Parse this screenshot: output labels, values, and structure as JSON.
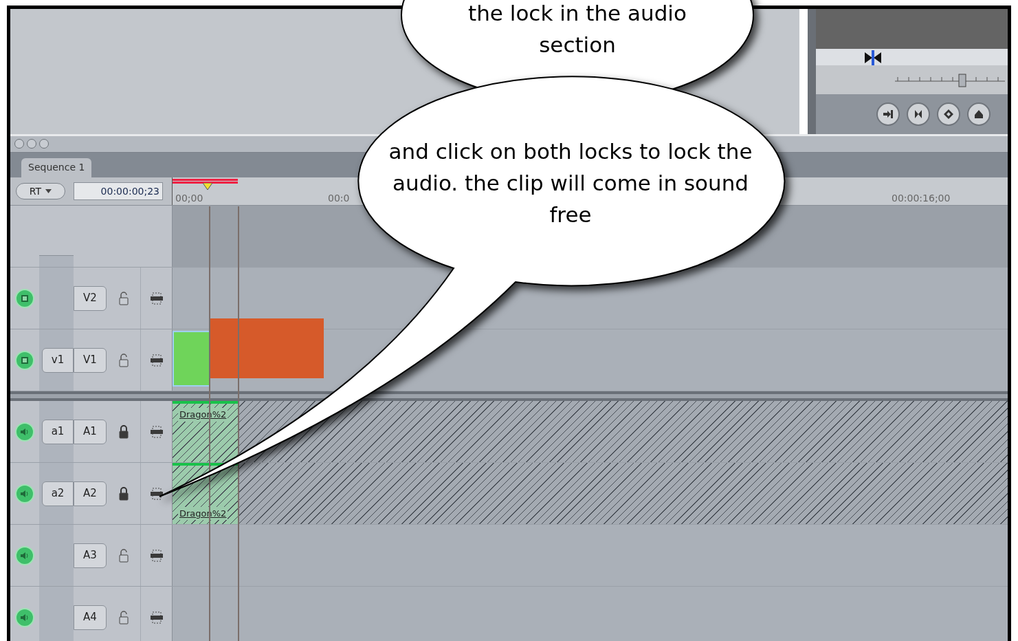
{
  "timeline": {
    "tab": {
      "label": "Sequence 1",
      "selected": true
    },
    "rt_button": "RT",
    "timecode": "00:00:00;23",
    "ruler_labels": [
      "00;00",
      "00:0",
      "00:00:16;00"
    ]
  },
  "tracks": [
    {
      "kind": "video",
      "dest": "V2",
      "locked": false
    },
    {
      "kind": "video",
      "source": "v1",
      "dest": "V1",
      "locked": false,
      "clips": [
        {
          "kind": "photo"
        },
        {
          "kind": "photo"
        }
      ]
    },
    {
      "kind": "audio",
      "source": "a1",
      "dest": "A1",
      "locked": true,
      "clips": [
        {
          "kind": "audio",
          "name": "Dragon%2"
        }
      ]
    },
    {
      "kind": "audio",
      "source": "a2",
      "dest": "A2",
      "locked": true,
      "clips": [
        {
          "kind": "audio",
          "name": "Dragon%2"
        }
      ]
    },
    {
      "kind": "audio",
      "dest": "A3",
      "locked": false
    },
    {
      "kind": "audio",
      "dest": "A4",
      "locked": false
    }
  ],
  "canvas": {
    "zoom_slider": {
      "level": 0.62
    }
  },
  "callouts": [
    {
      "text": "the lock in the audio section"
    },
    {
      "text": "and click on both locks to lock the audio. the clip will come in sound free"
    }
  ]
}
